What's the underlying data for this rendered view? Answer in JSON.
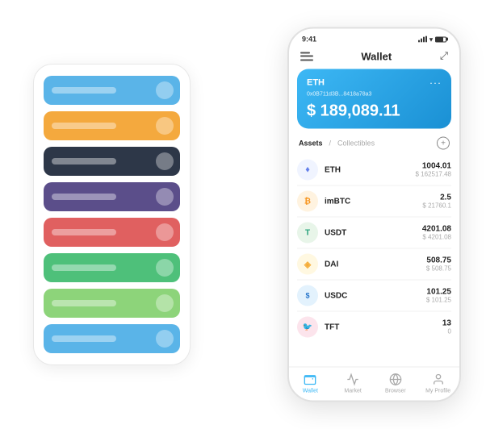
{
  "scene": {
    "background_color": "#ffffff"
  },
  "card_stack": {
    "cards": [
      {
        "color": "card-blue",
        "label": ""
      },
      {
        "color": "card-orange",
        "label": ""
      },
      {
        "color": "card-dark",
        "label": ""
      },
      {
        "color": "card-purple",
        "label": ""
      },
      {
        "color": "card-red",
        "label": ""
      },
      {
        "color": "card-green",
        "label": ""
      },
      {
        "color": "card-light-green",
        "label": ""
      },
      {
        "color": "card-sky",
        "label": ""
      }
    ]
  },
  "phone": {
    "status_bar": {
      "time": "9:41"
    },
    "header": {
      "title": "Wallet"
    },
    "eth_card": {
      "label": "ETH",
      "address": "0x0B711d3B...8418a78a3",
      "balance": "$ 189,089.11",
      "currency_symbol": "$"
    },
    "assets": {
      "tab_active": "Assets",
      "tab_inactive": "Collectibles",
      "divider": "/"
    },
    "tokens": [
      {
        "symbol": "ETH",
        "amount": "1004.01",
        "usd": "$ 162517.48",
        "icon_bg": "#f0f4ff",
        "icon_color": "#627eea",
        "icon_text": "♦"
      },
      {
        "symbol": "imBTC",
        "amount": "2.5",
        "usd": "$ 21760.1",
        "icon_bg": "#fff3e0",
        "icon_color": "#f7931a",
        "icon_text": "₿"
      },
      {
        "symbol": "USDT",
        "amount": "4201.08",
        "usd": "$ 4201.08",
        "icon_bg": "#e8f5e9",
        "icon_color": "#26a17b",
        "icon_text": "T"
      },
      {
        "symbol": "DAI",
        "amount": "508.75",
        "usd": "$ 508.75",
        "icon_bg": "#fff8e1",
        "icon_color": "#f5ac37",
        "icon_text": "◈"
      },
      {
        "symbol": "USDC",
        "amount": "101.25",
        "usd": "$ 101.25",
        "icon_bg": "#e3f2fd",
        "icon_color": "#2775ca",
        "icon_text": "$"
      },
      {
        "symbol": "TFT",
        "amount": "13",
        "usd": "0",
        "icon_bg": "#fce4ec",
        "icon_color": "#e91e8c",
        "icon_text": "🐦"
      }
    ],
    "bottom_nav": [
      {
        "label": "Wallet",
        "active": true
      },
      {
        "label": "Market",
        "active": false
      },
      {
        "label": "Browser",
        "active": false
      },
      {
        "label": "My Profile",
        "active": false
      }
    ]
  }
}
